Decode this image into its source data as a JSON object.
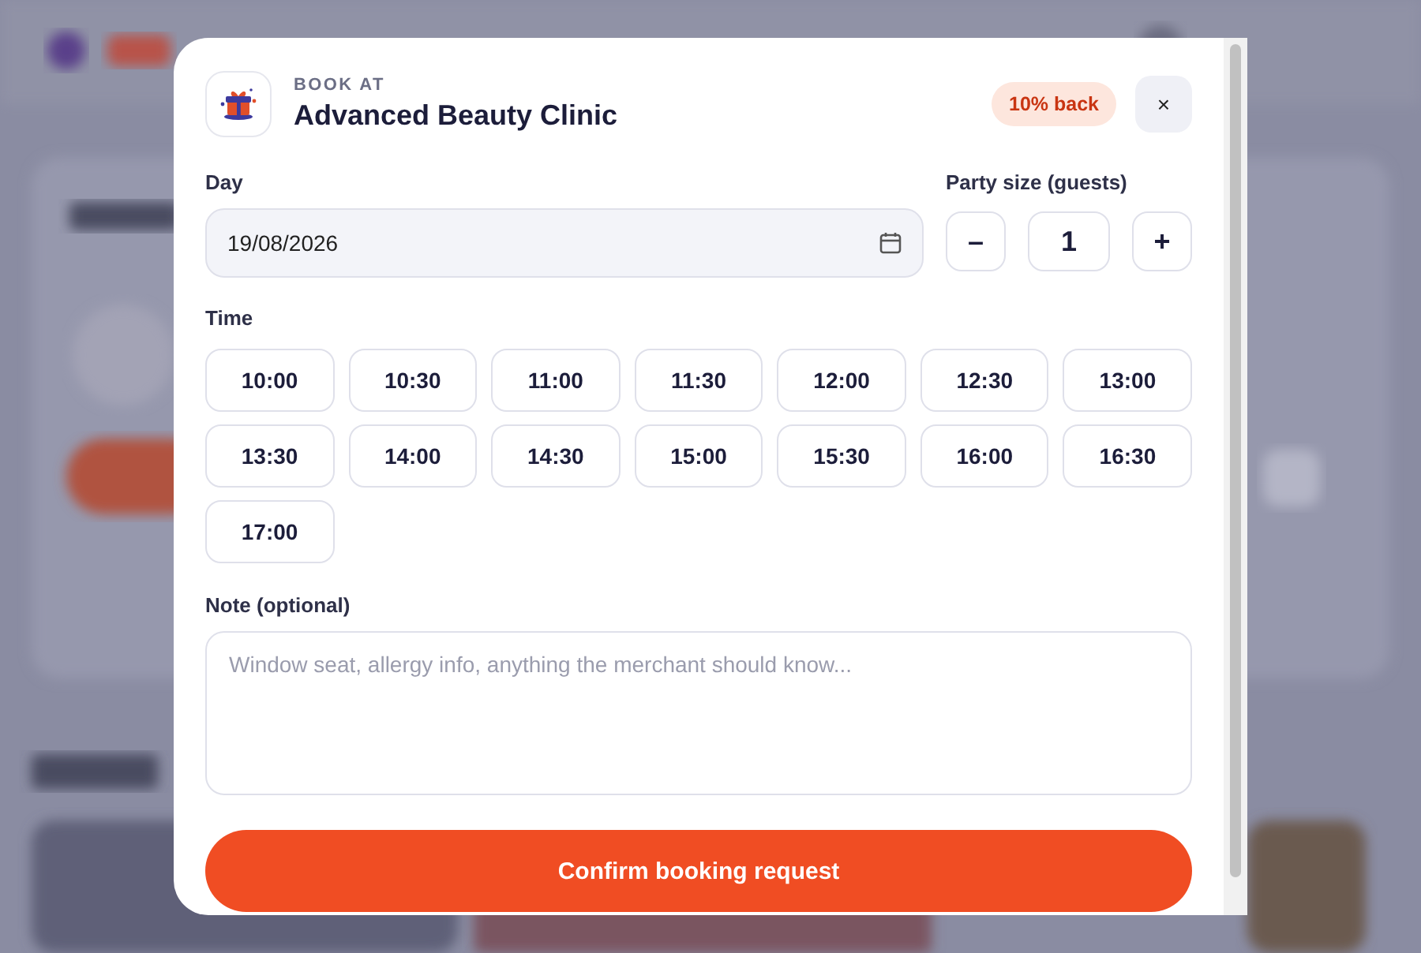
{
  "modal": {
    "eyebrow": "BOOK AT",
    "title": "Advanced Beauty Clinic",
    "cashback_badge": "10% back",
    "close": "×"
  },
  "day": {
    "label": "Day",
    "value": "19/08/2026"
  },
  "party_size": {
    "label": "Party size (guests)",
    "decrement": "–",
    "value": "1",
    "increment": "+"
  },
  "time": {
    "label": "Time",
    "slots": [
      {
        "label": "10:00",
        "selected": false
      },
      {
        "label": "10:30",
        "selected": false
      },
      {
        "label": "11:00",
        "selected": false
      },
      {
        "label": "11:30",
        "selected": false
      },
      {
        "label": "12:00",
        "selected": false
      },
      {
        "label": "12:30",
        "selected": false
      },
      {
        "label": "13:00",
        "selected": false
      },
      {
        "label": "13:30",
        "selected": false
      },
      {
        "label": "14:00",
        "selected": false
      },
      {
        "label": "14:30",
        "selected": false
      },
      {
        "label": "15:00",
        "selected": false
      },
      {
        "label": "15:30",
        "selected": false
      },
      {
        "label": "16:00",
        "selected": false
      },
      {
        "label": "16:30",
        "selected": false
      },
      {
        "label": "17:00",
        "selected": false
      }
    ]
  },
  "note": {
    "label": "Note (optional)",
    "placeholder": "Window seat, allergy info, anything the merchant should know..."
  },
  "confirm_button": "Confirm booking request"
}
